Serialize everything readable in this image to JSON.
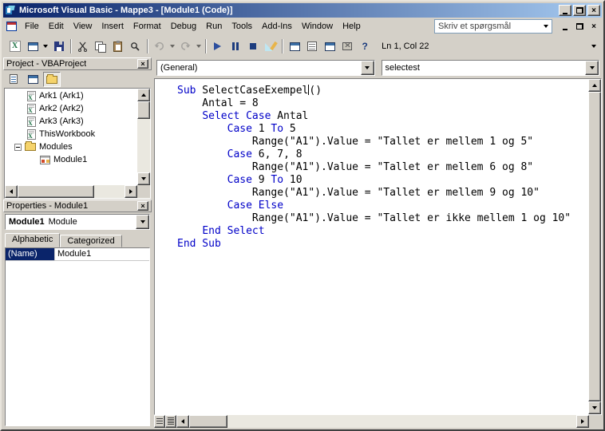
{
  "window": {
    "title": "Microsoft Visual Basic - Mappe3 - [Module1 (Code)]"
  },
  "menu": {
    "items": [
      "File",
      "Edit",
      "View",
      "Insert",
      "Format",
      "Debug",
      "Run",
      "Tools",
      "Add-Ins",
      "Window",
      "Help"
    ],
    "question_placeholder": "Skriv et spørgsmål"
  },
  "toolbar": {
    "caret_position": "Ln 1, Col 22",
    "icons": [
      "view-microsoft-excel",
      "insert-userform",
      "save",
      "cut",
      "copy",
      "paste",
      "find",
      "undo",
      "redo",
      "run-sub",
      "break",
      "reset",
      "design-mode",
      "project-explorer",
      "properties-window",
      "object-browser",
      "toolbox",
      "context-help",
      "toolbar-options"
    ]
  },
  "project": {
    "title": "Project - VBAProject",
    "toolbar_icons": [
      "view-code",
      "view-object",
      "toggle-folders"
    ],
    "tree": [
      {
        "icon": "worksheet-icon",
        "label": "Ark1 (Ark1)"
      },
      {
        "icon": "worksheet-icon",
        "label": "Ark2 (Ark2)"
      },
      {
        "icon": "worksheet-icon",
        "label": "Ark3 (Ark3)"
      },
      {
        "icon": "workbook-icon",
        "label": "ThisWorkbook"
      },
      {
        "icon": "folder-icon",
        "label": "Modules",
        "expanded": true
      },
      {
        "icon": "module-icon",
        "label": "Module1"
      }
    ]
  },
  "properties": {
    "title": "Properties - Module1",
    "selected_object": "Module1",
    "selected_type": "Module",
    "tabs": [
      "Alphabetic",
      "Categorized"
    ],
    "rows": [
      {
        "name": "(Name)",
        "value": "Module1"
      }
    ]
  },
  "code": {
    "object_dropdown": "(General)",
    "procedure_dropdown": "selectest",
    "keyword_color": "#0000c8",
    "lines": [
      [
        {
          "t": "kw",
          "s": "Sub"
        },
        {
          "t": "tx",
          "s": " SelectCaseExempel"
        },
        {
          "t": "caret",
          "s": ""
        },
        {
          "t": "tx",
          "s": "()"
        }
      ],
      [
        {
          "t": "tx",
          "s": "    Antal = 8"
        }
      ],
      [
        {
          "t": "tx",
          "s": "    "
        },
        {
          "t": "kw",
          "s": "Select Case"
        },
        {
          "t": "tx",
          "s": " Antal"
        }
      ],
      [
        {
          "t": "tx",
          "s": "        "
        },
        {
          "t": "kw",
          "s": "Case"
        },
        {
          "t": "tx",
          "s": " 1 "
        },
        {
          "t": "kw",
          "s": "To"
        },
        {
          "t": "tx",
          "s": " 5"
        }
      ],
      [
        {
          "t": "tx",
          "s": "            Range(\"A1\").Value = \"Tallet er mellem 1 og 5\""
        }
      ],
      [
        {
          "t": "tx",
          "s": "        "
        },
        {
          "t": "kw",
          "s": "Case"
        },
        {
          "t": "tx",
          "s": " 6, 7, 8"
        }
      ],
      [
        {
          "t": "tx",
          "s": "            Range(\"A1\").Value = \"Tallet er mellem 6 og 8\""
        }
      ],
      [
        {
          "t": "tx",
          "s": "        "
        },
        {
          "t": "kw",
          "s": "Case"
        },
        {
          "t": "tx",
          "s": " 9 "
        },
        {
          "t": "kw",
          "s": "To"
        },
        {
          "t": "tx",
          "s": " 10"
        }
      ],
      [
        {
          "t": "tx",
          "s": "            Range(\"A1\").Value = \"Tallet er mellem 9 og 10\""
        }
      ],
      [
        {
          "t": "tx",
          "s": "        "
        },
        {
          "t": "kw",
          "s": "Case Else"
        }
      ],
      [
        {
          "t": "tx",
          "s": "            Range(\"A1\").Value = \"Tallet er ikke mellem 1 og 10\""
        }
      ],
      [
        {
          "t": "tx",
          "s": "    "
        },
        {
          "t": "kw",
          "s": "End Select"
        }
      ],
      [
        {
          "t": "kw",
          "s": "End Sub"
        }
      ]
    ]
  },
  "colors": {
    "titlebar_start": "#0a246a",
    "titlebar_end": "#a6caf0",
    "button_face": "#d4d0c8",
    "selection": "#0a246a",
    "keyword": "#0000c8"
  }
}
